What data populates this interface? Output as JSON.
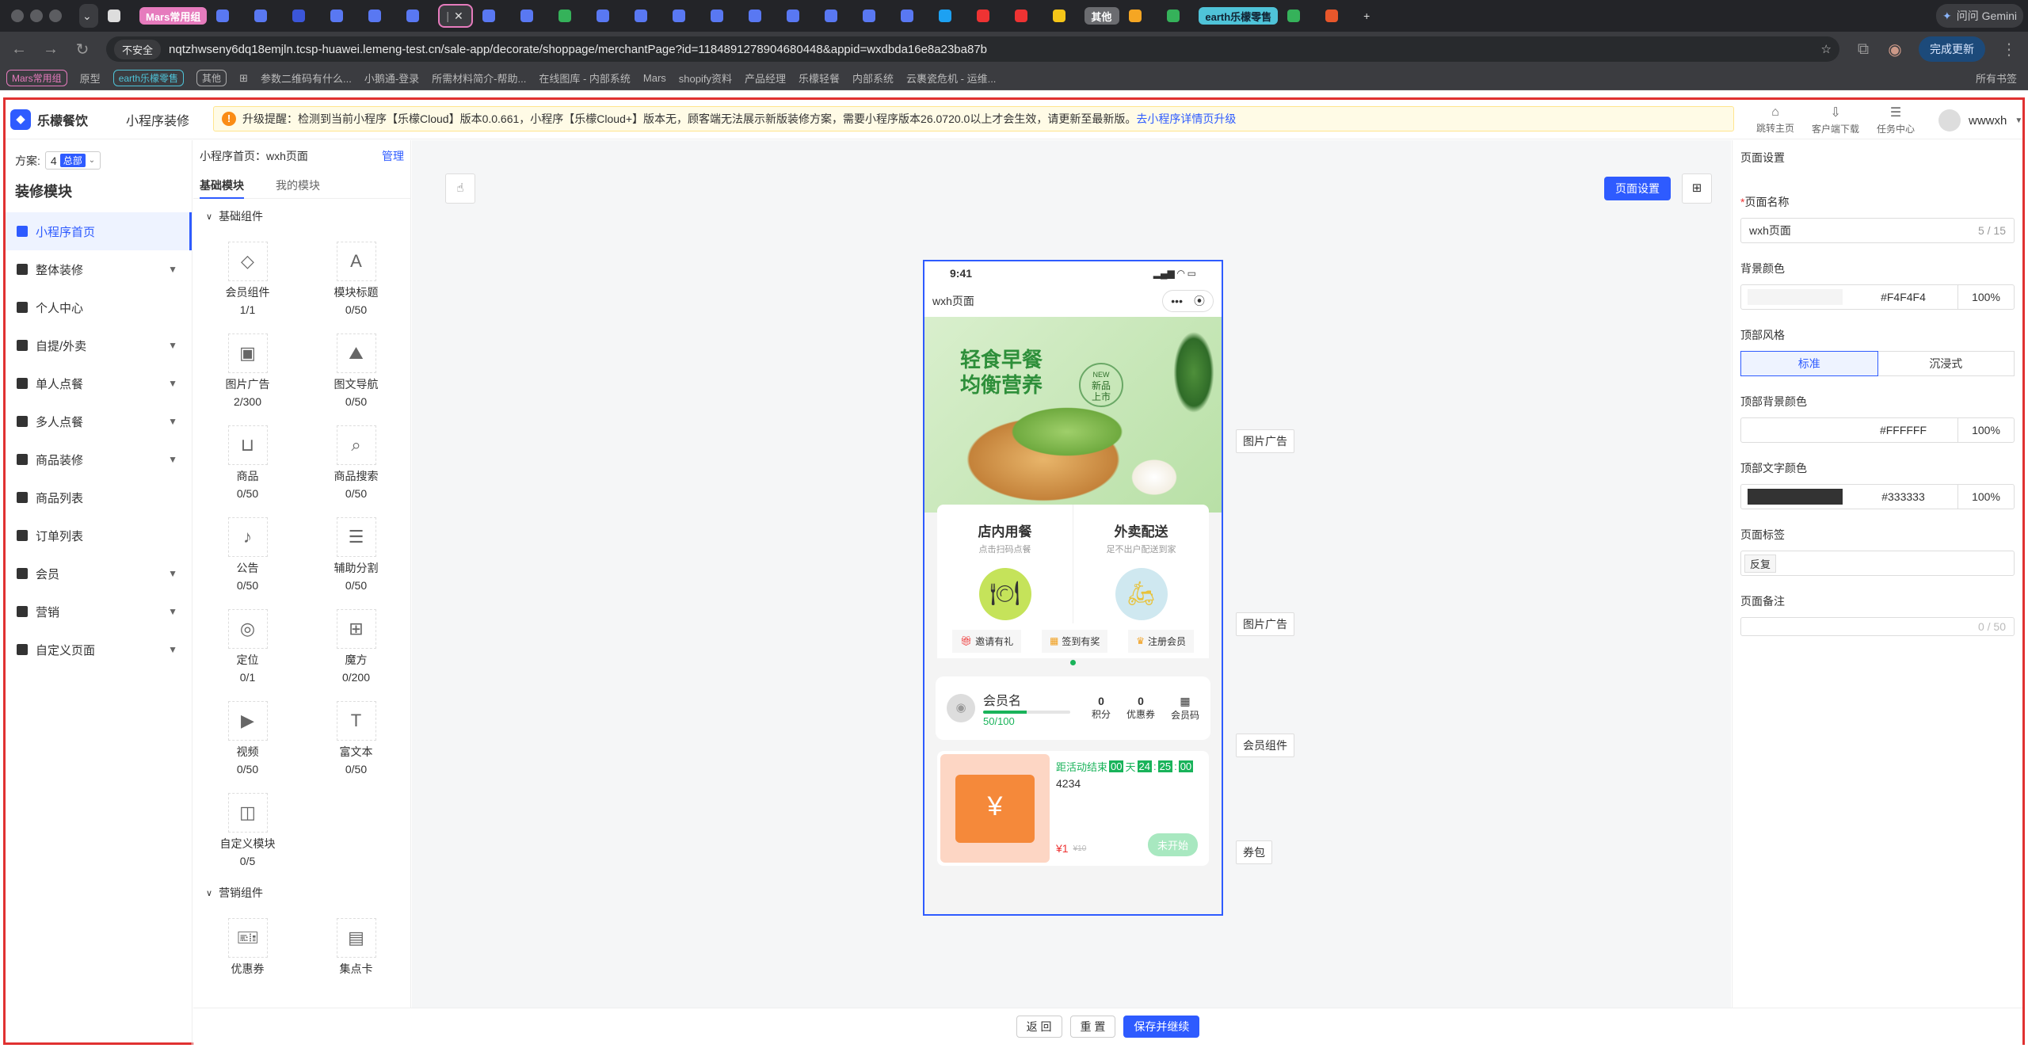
{
  "browser": {
    "tab_groups": [
      {
        "label": "Mars常用组",
        "color": "#e67bbd"
      },
      {
        "label": "其他",
        "color": "#6b6c70"
      },
      {
        "label": "earth乐檬零售",
        "color": "#4fc3d8"
      }
    ],
    "active_tab_title": "|",
    "gemini_button": "问问 Gemini",
    "insecure_label": "不安全",
    "url": "nqtzhwseny6dq18emjln.tcsp-huawei.lemeng-test.cn/sale-app/decorate/shoppage/merchantPage?id=1184891278904680448&appid=wxdbda16e8a23ba87b",
    "update_label": "完成更新",
    "bookmarks": [
      "Mars常用组",
      "原型",
      "earth乐檬零售",
      "其他",
      "参数二维码有什么...",
      "小鹅通-登录",
      "所需材料简介-帮助...",
      "在线图库 - 内部系统",
      "Mars",
      "shopify资料",
      "产品经理",
      "乐檬轻餐",
      "内部系统",
      "云裹瓷危机 - 运维..."
    ],
    "all_bookmarks": "所有书签"
  },
  "app": {
    "brand": "乐檬餐饮",
    "section_title": "小程序装修",
    "notice_prefix": "升级提醒：",
    "notice_text": "检测到当前小程序【乐檬Cloud】版本0.0.661，小程序【乐檬Cloud+】版本无，顾客端无法展示新版装修方案，需要小程序版本26.0720.0以上才会生效，请更新至最新版。",
    "notice_link": "去小程序详情页升级",
    "top_actions": [
      {
        "label": "跳转主页",
        "icon": "home-icon"
      },
      {
        "label": "客户端下载",
        "icon": "download-icon"
      },
      {
        "label": "任务中心",
        "icon": "task-icon"
      }
    ],
    "username": "wwwxh"
  },
  "leftnav": {
    "plan_label": "方案:",
    "plan_value": "4",
    "plan_tag": "总部",
    "title": "装修模块",
    "items": [
      {
        "label": "小程序首页",
        "active": true,
        "expandable": false
      },
      {
        "label": "整体装修",
        "expandable": true
      },
      {
        "label": "个人中心",
        "expandable": false
      },
      {
        "label": "自提/外卖",
        "expandable": true
      },
      {
        "label": "单人点餐",
        "expandable": true
      },
      {
        "label": "多人点餐",
        "expandable": true
      },
      {
        "label": "商品装修",
        "expandable": true
      },
      {
        "label": "商品列表",
        "expandable": false
      },
      {
        "label": "订单列表",
        "expandable": false
      },
      {
        "label": "会员",
        "expandable": true
      },
      {
        "label": "营销",
        "expandable": true
      },
      {
        "label": "自定义页面",
        "expandable": true
      }
    ]
  },
  "modules": {
    "page_label": "小程序首页：wxh页面",
    "manage": "管理",
    "tabs": [
      "基础模块",
      "我的模块"
    ],
    "basic_group": "基础组件",
    "basic": [
      {
        "label": "会员组件",
        "count": "1/1",
        "icon": "diamond-icon"
      },
      {
        "label": "模块标题",
        "count": "0/50",
        "icon": "title-icon"
      },
      {
        "label": "图片广告",
        "count": "2/300",
        "icon": "image-icon"
      },
      {
        "label": "图文导航",
        "count": "0/50",
        "icon": "image-nav-icon"
      },
      {
        "label": "商品",
        "count": "0/50",
        "icon": "bag-icon"
      },
      {
        "label": "商品搜索",
        "count": "0/50",
        "icon": "search-icon"
      },
      {
        "label": "公告",
        "count": "0/50",
        "icon": "speaker-icon"
      },
      {
        "label": "辅助分割",
        "count": "0/50",
        "icon": "divider-icon"
      },
      {
        "label": "定位",
        "count": "0/1",
        "icon": "location-icon"
      },
      {
        "label": "魔方",
        "count": "0/200",
        "icon": "cube-icon"
      },
      {
        "label": "视频",
        "count": "0/50",
        "icon": "video-icon"
      },
      {
        "label": "富文本",
        "count": "0/50",
        "icon": "text-icon"
      },
      {
        "label": "自定义模块",
        "count": "0/5",
        "icon": "custom-icon"
      }
    ],
    "marketing_group": "营销组件",
    "marketing": [
      {
        "label": "优惠券",
        "icon": "coupon-icon"
      },
      {
        "label": "集点卡",
        "icon": "gift-icon"
      }
    ]
  },
  "canvas": {
    "page_settings_btn": "页面设置",
    "phone": {
      "time": "9:41",
      "page_title": "wxh页面",
      "banner_text1": "轻食早餐",
      "banner_text2": "均衡营养",
      "banner_badge1": "NEW",
      "banner_badge2": "新品",
      "banner_badge3": "上市",
      "dine_in_title": "店内用餐",
      "dine_in_sub": "点击扫码点餐",
      "delivery_title": "外卖配送",
      "delivery_sub": "足不出户配送到家",
      "quick_links": [
        "邀请有礼",
        "签到有奖",
        "注册会员"
      ],
      "member_name": "会员名",
      "member_progress": "50/100",
      "member_progress_fraction": 0.5,
      "member_stats": [
        {
          "value": "0",
          "label": "积分"
        },
        {
          "value": "0",
          "label": "优惠券"
        },
        {
          "value": "",
          "label": "会员码"
        }
      ],
      "coupon_countdown_label": "距活动结束",
      "coupon_countdown": [
        "00",
        "天",
        "24",
        "25",
        "00"
      ],
      "coupon_name": "4234",
      "coupon_price": "¥1",
      "coupon_old_price": "¥10",
      "coupon_btn": "未开始"
    },
    "side_tags": [
      "图片广告",
      "图片广告",
      "会员组件",
      "券包"
    ]
  },
  "rightpanel": {
    "title": "页面设置",
    "name_label": "页面名称",
    "name_value": "wxh页面",
    "name_count": "5 / 15",
    "bg_label": "背景颜色",
    "bg_hex": "#F4F4F4",
    "bg_pct": "100%",
    "style_label": "顶部风格",
    "style_options": [
      "标准",
      "沉浸式"
    ],
    "top_bg_label": "顶部背景颜色",
    "top_bg_hex": "#FFFFFF",
    "top_bg_pct": "100%",
    "top_text_label": "顶部文字颜色",
    "top_text_hex": "#333333",
    "top_text_pct": "100%",
    "tag_label": "页面标签",
    "tag_value": "反复",
    "remark_label": "页面备注",
    "remark_count": "0 / 50"
  },
  "footer": {
    "back": "返 回",
    "reset": "重 置",
    "save": "保存并继续"
  },
  "colors": {
    "primary": "#2e5bff",
    "frame_red": "#e03131",
    "member_green": "#19b35a"
  }
}
